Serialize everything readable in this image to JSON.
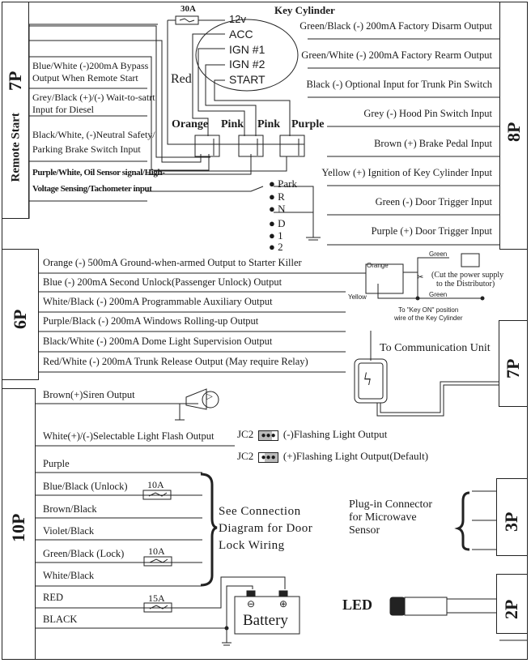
{
  "connectors": {
    "remote_start_7p": {
      "label": "7P",
      "sublabel": "Remote Start",
      "wires": [
        "Blue/White (-)200mA Bypass Output When Remote Start",
        "Grey/Black (+)/(-) Wait-to-satrt Input for Diesel",
        "Black/White, (-)Neutral Safety/ Parking Brake Switch Input",
        "Purple/White, Oil Sensor signal/High- Voltage Sensing/Tachometer input"
      ],
      "wire_lines": [
        [
          "Blue/White (-)200mA Bypass",
          "Output When Remote Start"
        ],
        [
          "Grey/Black (+)/(-) Wait-to-satrt",
          "Input for Diesel"
        ],
        [
          "Black/White, (-)Neutral Safety/",
          "Parking Brake Switch Input"
        ],
        [
          "Purple/White, Oil Sensor signal/High-",
          "Voltage Sensing/Tachometer input"
        ]
      ]
    },
    "p8": {
      "label": "8P",
      "wires": [
        "Green/Black (-) 200mA Factory Disarm Output",
        "Green/White (-) 200mA Factory Rearm Output",
        "Black (-) Optional Input for Trunk Pin Switch",
        "Grey (-) Hood Pin Switch Input",
        "Brown (+) Brake Pedal Input",
        "Yellow (+) Ignition of Key Cylinder Input",
        "Green (-) Door Trigger Input",
        "Purple (+) Door Trigger Input"
      ]
    },
    "p6": {
      "label": "6P",
      "wires": [
        "Orange (-) 500mA Ground-when-armed Output to Starter Killer",
        "Blue (-) 200mA Second Unlock(Passenger Unlock) Output",
        "White/Black (-) 200mA Programmable Auxiliary Output",
        "Purple/Black (-) 200mA Windows Rolling-up Output",
        "Black/White (-) 200mA Dome Light Supervision Output",
        "Red/White (-) 200mA Trunk Release Output (May require Relay)"
      ]
    },
    "p7_comm": {
      "label": "7P"
    },
    "p10": {
      "label": "10P",
      "wires": [
        "Brown(+)Siren Output",
        "White(+)/(-)Selectable Light Flash Output",
        "Purple",
        "Blue/Black  (Unlock)",
        "Brown/Black",
        "Violet/Black",
        "Green/Black  (Lock)",
        "White/Black",
        "RED",
        "BLACK"
      ]
    },
    "p3": {
      "label": "3P"
    },
    "p2": {
      "label": "2P"
    }
  },
  "key_cylinder": {
    "title": "Key Cylinder",
    "fuse": "30A",
    "terminals": [
      "12v",
      "ACC",
      "IGN #1",
      "IGN #2",
      "START"
    ],
    "wire_red": "Red",
    "relay_labels": [
      "Orange",
      "Pink",
      "Pink",
      "Purple"
    ]
  },
  "gear_selector": {
    "positions": [
      "Park",
      "R",
      "N",
      "D",
      "1",
      "2"
    ]
  },
  "starter_killer": {
    "relay_label": "Orange",
    "yellow": "Yellow",
    "green_top": "Green",
    "green_bottom": "Green",
    "cut_note": [
      "(Cut the power supply",
      "to the Distributor)"
    ],
    "key_on_note": [
      "To \"Key ON\" position",
      "wire of the Key Cylinder"
    ]
  },
  "communication": {
    "label": "To Communication Unit"
  },
  "jumpers": [
    {
      "id": "JC2",
      "label": "(-)Flashing Light Output"
    },
    {
      "id": "JC2",
      "label": "(+)Flashing Light Output(Default)"
    }
  ],
  "door_lock": {
    "fuse_unlock": "10A",
    "fuse_lock": "10A",
    "note": [
      "See Connection",
      "Diagram for Door",
      "Lock Wiring"
    ]
  },
  "power": {
    "fuse": "15A",
    "battery_label": "Battery",
    "neg": "⊖",
    "pos": "⊕"
  },
  "microwave": {
    "note": [
      "Plug-in Connector",
      "for Microwave",
      "Sensor"
    ]
  },
  "led": {
    "label": "LED"
  }
}
